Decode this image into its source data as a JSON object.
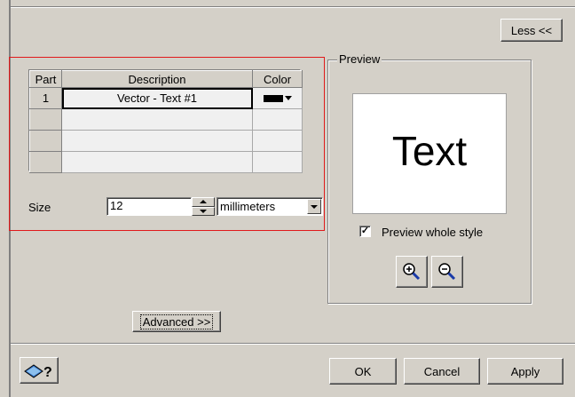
{
  "window": {
    "less_button": "Less <<"
  },
  "parts_table": {
    "headers": [
      "Part",
      "Description",
      "Color"
    ],
    "rows": [
      {
        "part": "1",
        "description": "Vector - Text #1",
        "color": "#000000"
      },
      {
        "part": "",
        "description": "",
        "color": ""
      },
      {
        "part": "",
        "description": "",
        "color": ""
      },
      {
        "part": "",
        "description": "",
        "color": ""
      }
    ]
  },
  "size": {
    "label": "Size",
    "value": "12",
    "unit": "millimeters"
  },
  "preview": {
    "group_title": "Preview",
    "sample_text": "Text",
    "whole_style_label": "Preview whole style",
    "whole_style_checked": true,
    "zoom_in_icon": "zoom-in-icon",
    "zoom_out_icon": "zoom-out-icon"
  },
  "advanced_button": "Advanced >>",
  "footer": {
    "help_icon": "help-book-icon",
    "ok": "OK",
    "cancel": "Cancel",
    "apply": "Apply"
  },
  "colors": {
    "highlight_border": "#e0191b",
    "dialog_bg": "#d4d0c8"
  }
}
